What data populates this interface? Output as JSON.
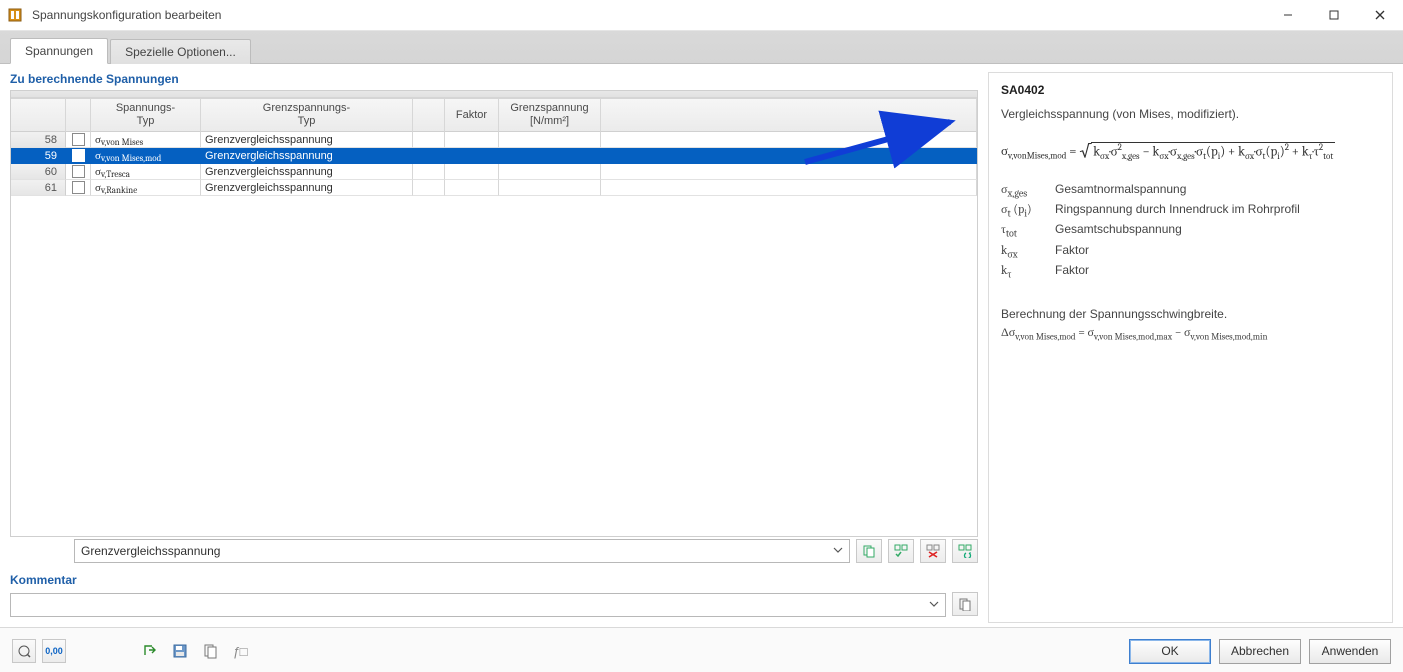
{
  "window": {
    "title": "Spannungskonfiguration bearbeiten"
  },
  "tabs": {
    "spannungen": "Spannungen",
    "spezielle": "Spezielle Optionen..."
  },
  "section": {
    "title": "Zu berechnende Spannungen"
  },
  "columns": {
    "num": "",
    "chk": "",
    "type": "Spannungs-\nTyp",
    "limit": "Grenzspannungs-\nTyp",
    "gap": "",
    "faktor": "Faktor",
    "gnm": "Grenzspannung\n[N/mm²]",
    "rest": ""
  },
  "rows": [
    {
      "n": "58",
      "type": "σv,von Mises",
      "limit": "Grenzvergleichsspannung",
      "sel": false
    },
    {
      "n": "59",
      "type": "σv,von Mises,mod",
      "limit": "Grenzvergleichsspannung",
      "sel": true
    },
    {
      "n": "60",
      "type": "σv,Tresca",
      "limit": "Grenzvergleichsspannung",
      "sel": false
    },
    {
      "n": "61",
      "type": "σv,Rankine",
      "limit": "Grenzvergleichsspannung",
      "sel": false
    }
  ],
  "belowgrid": {
    "selected_limit": "Grenzvergleichsspannung",
    "kommentar_label": "Kommentar",
    "kommentar_value": ""
  },
  "help": {
    "code": "SA0402",
    "title": "Vergleichsspannung (von Mises, modifiziert).",
    "defs": {
      "sigma_x_ges": "Gesamtnormalspannung",
      "sigma_t_pi": "Ringspannung durch Innendruck im Rohrprofil",
      "tau_tot": "Gesamtschubspannung",
      "k_sigma_x": "Faktor",
      "k_tau": "Faktor"
    },
    "calc_text": "Berechnung der Spannungsschwingbreite."
  },
  "buttons": {
    "ok": "OK",
    "cancel": "Abbrechen",
    "apply": "Anwenden"
  }
}
